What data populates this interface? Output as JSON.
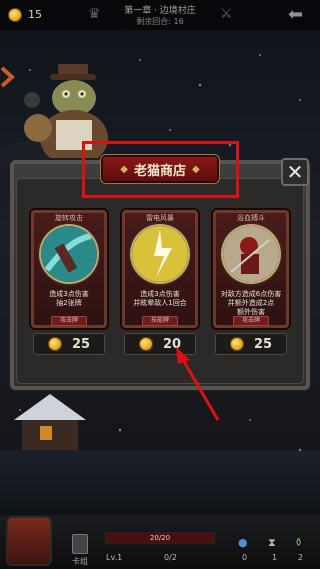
{
  "topbar": {
    "gold": "15",
    "chapter": "第一章 · 边境村庄",
    "remaining": "剩余回合: 16"
  },
  "shop": {
    "title": "老猫商店",
    "close": "✕"
  },
  "cards": [
    {
      "name": "旋转攻击",
      "desc": "造成3点伤害\n抽2张牌",
      "tag": "攻击牌",
      "price": "25",
      "art": "blade"
    },
    {
      "name": "雷电风暴",
      "desc": "造成3点伤害\n并眩晕敌人1回合",
      "tag": "技能牌",
      "price": "20",
      "art": "lightning"
    },
    {
      "name": "浴血搏斗",
      "desc": "对敌方造成6点伤害\n并额外造成2点\n额外伤害",
      "tag": "攻击牌",
      "price": "25",
      "art": "fighter"
    }
  ],
  "bottom": {
    "deck": "卡组",
    "hp": "20/20",
    "level": "Lv.1",
    "xp": "0/2",
    "stat1": "0",
    "stat2": "1",
    "stat3": "2"
  },
  "colors": {
    "highlight": "#e01010",
    "arrow": "#e01010",
    "title_plate": "#8b1717"
  }
}
